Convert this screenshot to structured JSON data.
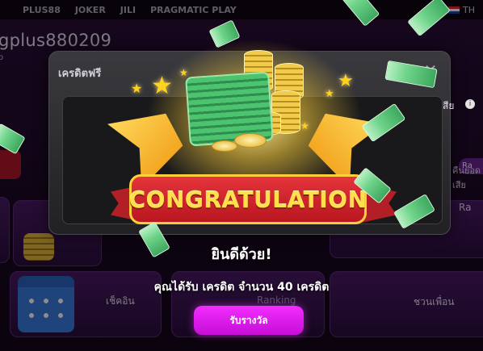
{
  "providers": [
    "PLUS88",
    "JOKER",
    "JILI",
    "PRAGMATIC PLAY"
  ],
  "language": {
    "label": "TH",
    "flag": "thai-flag"
  },
  "account": {
    "username": "gplus880209",
    "sub": "o"
  },
  "tiles": {
    "checkin_label": "เช็คอิน",
    "invite_label": "ชวนเพื่อน",
    "rank_label": "Ra",
    "rank_label_2": "Ranking",
    "loss_label": "คืนยอดเสีย",
    "side_right_label": "สีย"
  },
  "modal": {
    "title": "เครดิตฟรี",
    "close_icon": "close-icon",
    "banner": "CONGRATULATION",
    "headline": "ยินดีด้วย!",
    "message": "คุณได้รับ เครดิต จำนวน 40 เครดิต",
    "claim_button": "รับรางวัล"
  },
  "colors": {
    "accent_button": "#e01ef0",
    "banner_red": "#d12a31",
    "banner_text": "#ffe04a",
    "modal_bg": "#2b2b2e"
  }
}
